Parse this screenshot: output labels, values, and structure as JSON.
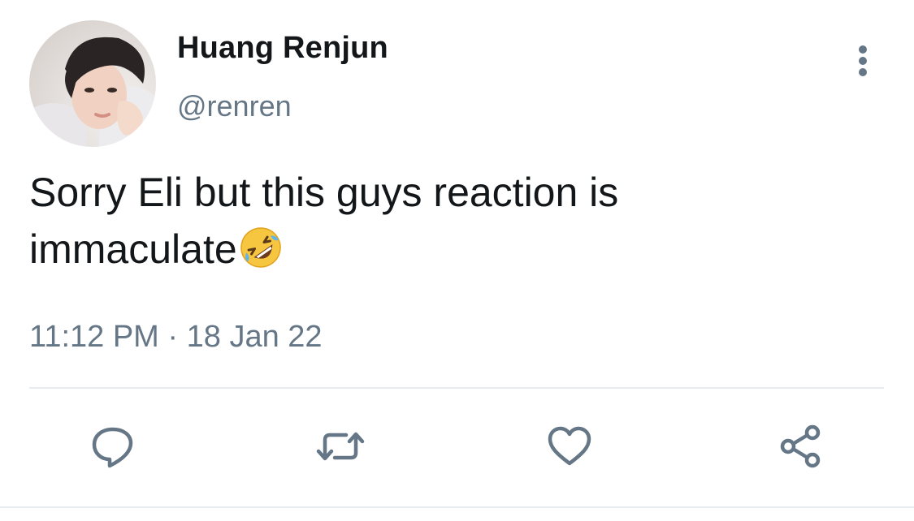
{
  "tweet": {
    "author": {
      "display_name": "Huang Renjun",
      "handle": "@renren",
      "avatar": "profile-photo"
    },
    "text_line1": "Sorry Eli but this guys reaction is",
    "text_line2": "immaculate",
    "emoji": "rolling-on-the-floor-laughing",
    "time": "11:12 PM",
    "separator": " · ",
    "date": "18 Jan 22"
  },
  "actions": [
    {
      "name": "reply",
      "icon": "speech-bubble-icon"
    },
    {
      "name": "retweet",
      "icon": "retweet-icon"
    },
    {
      "name": "like",
      "icon": "heart-icon"
    },
    {
      "name": "share",
      "icon": "share-icon"
    }
  ],
  "colors": {
    "text": "#14171a",
    "secondary": "#657786",
    "icon": "#657786",
    "divider": "#e6ecf0"
  }
}
